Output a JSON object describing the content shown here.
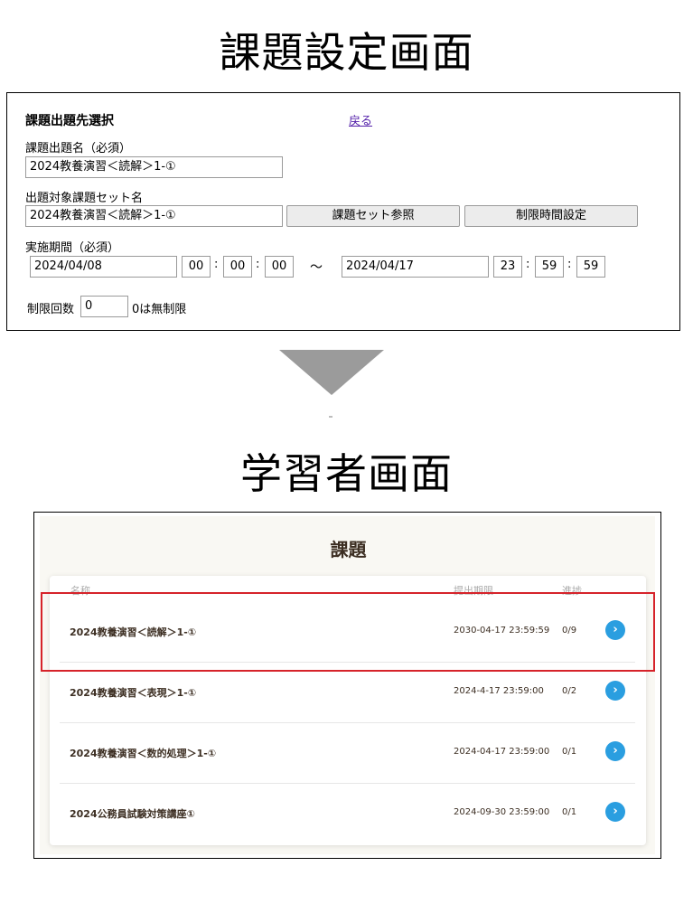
{
  "titles": {
    "settings_screen": "課題設定画面",
    "learner_screen": "学習者画面"
  },
  "settings": {
    "heading": "課題出題先選択",
    "back_link": "戻る",
    "name_label": "課題出題名（必須）",
    "name_value": "2024教養演習＜読解＞1-①",
    "set_label": "出題対象課題セット名",
    "set_value": "2024教養演習＜読解＞1-①",
    "set_ref_button": "課題セット参照",
    "time_limit_button": "制限時間設定",
    "period_label": "実施期間（必須）",
    "start_date": "2024/04/08",
    "start_h": "00",
    "start_m": "00",
    "start_s": "00",
    "range_sep": "～",
    "end_date": "2024/04/17",
    "end_h": "23",
    "end_m": "59",
    "end_s": "59",
    "colon": ":",
    "limit_label": "制限回数",
    "limit_value": "0",
    "limit_note": "0は無制限"
  },
  "learner": {
    "title": "課題",
    "columns": {
      "name": "名称",
      "deadline": "提出期限",
      "progress": "進捗"
    },
    "rows": [
      {
        "name": "2024教養演習＜読解＞1-①",
        "deadline": "2030-04-17 23:59:59",
        "progress": "0/9",
        "highlighted": true
      },
      {
        "name": "2024教養演習＜表現＞1-①",
        "deadline": "2024-4-17 23:59:00",
        "progress": "0/2"
      },
      {
        "name": "2024教養演習＜数的処理＞1-①",
        "deadline": "2024-04-17 23:59:00",
        "progress": "0/1"
      },
      {
        "name": "2024公務員試験対策講座①",
        "deadline": "2024-09-30 23:59:00",
        "progress": "0/1"
      }
    ],
    "row_button_icon": "chevron-right-icon",
    "row_button_glyph": "›"
  },
  "colors": {
    "accent_blue": "#2a9ee0",
    "highlight_red": "#d6232a",
    "arrow_gray": "#9b9b9b",
    "text_brown": "#3c2e22"
  }
}
